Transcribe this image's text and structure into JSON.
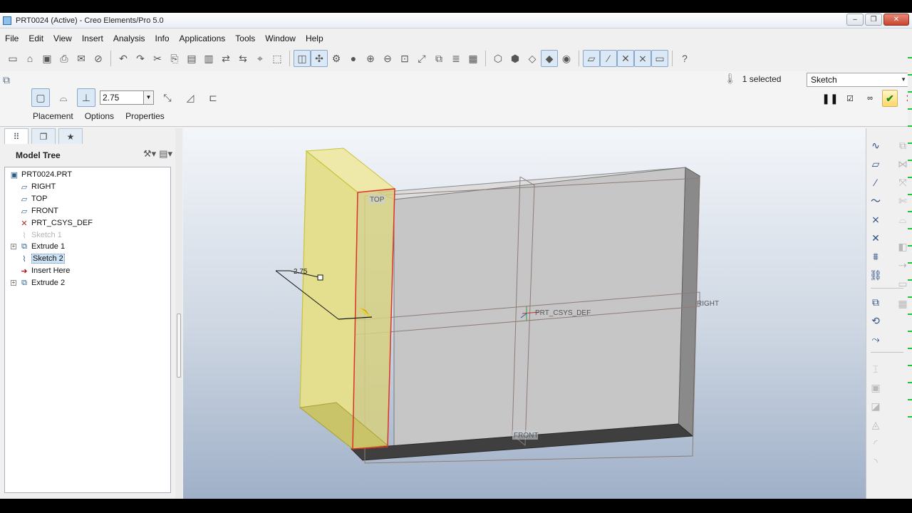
{
  "window": {
    "title": "PRT0024 (Active) - Creo Elements/Pro 5.0",
    "minimize": "–",
    "restore": "❐",
    "close": "✕"
  },
  "menu": [
    "File",
    "Edit",
    "View",
    "Insert",
    "Analysis",
    "Info",
    "Applications",
    "Tools",
    "Window",
    "Help"
  ],
  "dashboard": {
    "depth_value": "2.75",
    "tabs": [
      "Placement",
      "Options",
      "Properties"
    ],
    "selection_count": "1 selected",
    "filter_value": "Sketch"
  },
  "model_tree": {
    "nav_tabs": [
      "model-tree",
      "layers",
      "favorites"
    ],
    "title": "Model Tree",
    "items": [
      {
        "label": "PRT0024.PRT",
        "icon": "part-icon",
        "faded": false,
        "highlight": false
      },
      {
        "label": "RIGHT",
        "icon": "datum-plane-icon",
        "faded": false,
        "highlight": false
      },
      {
        "label": "TOP",
        "icon": "datum-plane-icon",
        "faded": false,
        "highlight": false
      },
      {
        "label": "FRONT",
        "icon": "datum-plane-icon",
        "faded": false,
        "highlight": false
      },
      {
        "label": "PRT_CSYS_DEF",
        "icon": "csys-icon",
        "faded": false,
        "highlight": false
      },
      {
        "label": "Sketch 1",
        "icon": "sketch-icon",
        "faded": true,
        "highlight": false
      },
      {
        "label": "Extrude 1",
        "icon": "extrude-icon",
        "faded": false,
        "highlight": false
      },
      {
        "label": "Sketch 2",
        "icon": "sketch-icon",
        "faded": false,
        "highlight": true
      },
      {
        "label": "Insert Here",
        "icon": "insert-arrow-icon",
        "faded": false,
        "highlight": false
      },
      {
        "label": "Extrude 2",
        "icon": "extrude-icon",
        "faded": false,
        "highlight": false
      }
    ]
  },
  "viewport": {
    "dimension_label": "2.75",
    "datum_top": "TOP",
    "datum_right": "RIGHT",
    "datum_front": "FRONT",
    "csys_label": "PRT_CSYS_DEF"
  },
  "colors": {
    "accent": "#2b4f86",
    "preview_fill": "#e6e39a",
    "preview_edge": "#d8d24a",
    "sketch_edge": "#e0302a",
    "confirm": "#1b8a1b",
    "cancel": "#cc1a1a"
  }
}
